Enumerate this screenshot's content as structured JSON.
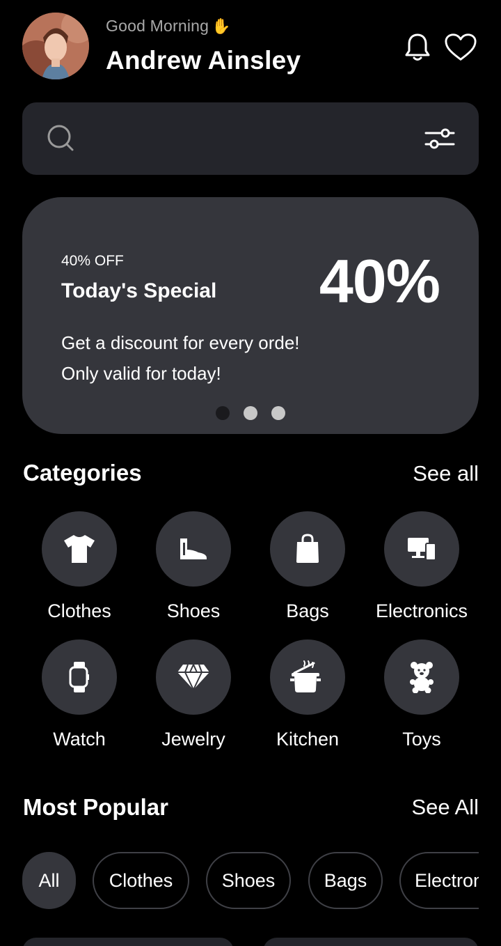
{
  "header": {
    "greeting": "Good Morning",
    "name": "Andrew Ainsley"
  },
  "search": {
    "placeholder": ""
  },
  "promo": {
    "off_label": "40% OFF",
    "title": "Today's Special",
    "big": "40%",
    "line1": "Get a discount for every orde!",
    "line2": "Only valid for today!",
    "active_slide": 1,
    "slides": 3
  },
  "categories": {
    "title": "Categories",
    "see_all": "See all",
    "items": [
      {
        "label": "Clothes",
        "icon": "tshirt-icon"
      },
      {
        "label": "Shoes",
        "icon": "boot-icon"
      },
      {
        "label": "Bags",
        "icon": "bag-icon"
      },
      {
        "label": "Electronics",
        "icon": "devices-icon"
      },
      {
        "label": "Watch",
        "icon": "watch-icon"
      },
      {
        "label": "Jewelry",
        "icon": "diamond-icon"
      },
      {
        "label": "Kitchen",
        "icon": "pot-icon"
      },
      {
        "label": "Toys",
        "icon": "teddy-bear-icon"
      }
    ]
  },
  "popular": {
    "title": "Most Popular",
    "see_all": "See All",
    "chips": [
      "All",
      "Clothes",
      "Shoes",
      "Bags",
      "Electronics"
    ]
  },
  "colors": {
    "background": "#000000",
    "card": "#35363c",
    "search_bg": "#24252b",
    "muted_text": "#a9a9a9"
  }
}
